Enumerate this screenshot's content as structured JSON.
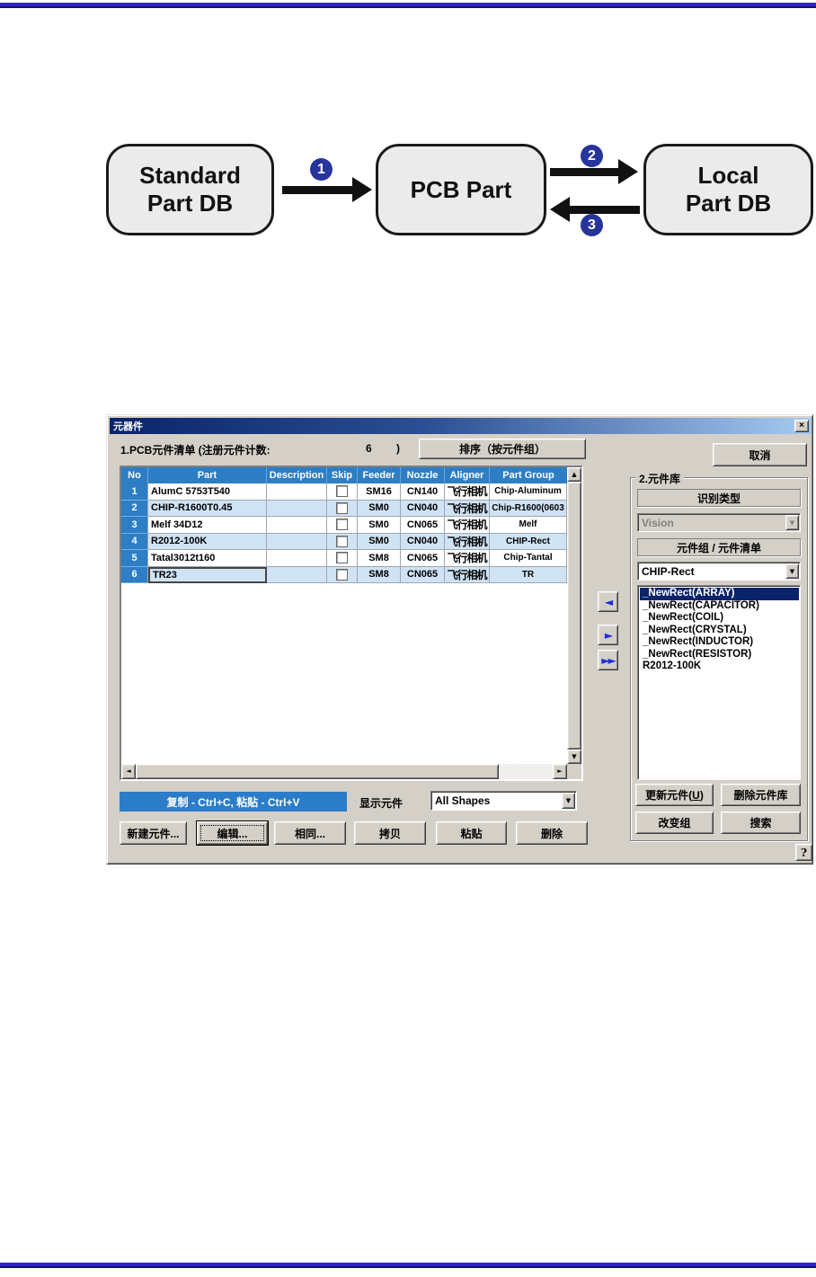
{
  "colors": {
    "accent_blue": "#2d7ec4",
    "row_alt_blue": "#cfe3f5",
    "selection_navy": "#0a246a",
    "rule_blue": "#2f22d6",
    "badge_blue": "#27349b",
    "dialog_face": "#d4d0c8",
    "title_gradient_start": "#0a246a",
    "title_gradient_end": "#a6caf0"
  },
  "diagram": {
    "boxes": [
      {
        "line1": "Standard",
        "line2": "Part DB"
      },
      {
        "line1": "PCB Part",
        "line2": ""
      },
      {
        "line1": "Local",
        "line2": "Part DB"
      }
    ],
    "steps": [
      "1",
      "2",
      "3"
    ]
  },
  "dialog": {
    "title": "元器件",
    "icons": {
      "close": "×",
      "combo_arrow": "▼",
      "scroll_up": "▲",
      "scroll_down": "▼",
      "scroll_left": "◄",
      "scroll_right": "►",
      "arrow_left": "◄",
      "arrow_right": "►",
      "arrow_double_right": "►►",
      "help": "?"
    },
    "header": {
      "list_label": "1.PCB元件清单  (注册元件计数:",
      "count": "6",
      "count_close": ")",
      "sort_button": "排序（按元件组）",
      "cancel_button": "取消"
    },
    "table": {
      "columns": [
        "No",
        "Part",
        "Description",
        "Skip",
        "Feeder",
        "Nozzle",
        "Aligner",
        "Part Group"
      ],
      "rows": [
        {
          "no": "1",
          "part": "AlumC 5753T540",
          "description": "",
          "skip": false,
          "feeder": "SM16",
          "nozzle": "CN140",
          "aligner": "飞行相机",
          "part_group": "Chip-Aluminum",
          "selected": false
        },
        {
          "no": "2",
          "part": "CHIP-R1600T0.45",
          "description": "",
          "skip": false,
          "feeder": "SM0",
          "nozzle": "CN040",
          "aligner": "飞行相机",
          "part_group": "Chip-R1600(0603",
          "selected": false
        },
        {
          "no": "3",
          "part": "Melf 34D12",
          "description": "",
          "skip": false,
          "feeder": "SM0",
          "nozzle": "CN065",
          "aligner": "飞行相机",
          "part_group": "Melf",
          "selected": false
        },
        {
          "no": "4",
          "part": "R2012-100K",
          "description": "",
          "skip": false,
          "feeder": "SM0",
          "nozzle": "CN040",
          "aligner": "飞行相机",
          "part_group": "CHIP-Rect",
          "selected": false
        },
        {
          "no": "5",
          "part": "Tatal3012t160",
          "description": "",
          "skip": false,
          "feeder": "SM8",
          "nozzle": "CN065",
          "aligner": "飞行相机",
          "part_group": "Chip-Tantal",
          "selected": false
        },
        {
          "no": "6",
          "part": "TR23",
          "description": "",
          "skip": false,
          "feeder": "SM8",
          "nozzle": "CN065",
          "aligner": "飞行相机",
          "part_group": "TR",
          "selected": true
        }
      ]
    },
    "footer": {
      "copy_hint": "复制 - Ctrl+C, 粘贴 - Ctrl+V",
      "show_label": "显示元件",
      "shape_filter": "All Shapes",
      "buttons": [
        "新建元件...",
        "编辑...",
        "相同...",
        "拷贝",
        "粘贴",
        "删除"
      ]
    },
    "library": {
      "group_title": "2.元件库",
      "recognition_label": "识别类型",
      "vision_value": "Vision",
      "group_list_label": "元件组 / 元件清单",
      "group_value": "CHIP-Rect",
      "items": [
        "_NewRect(ARRAY)",
        "_NewRect(CAPACITOR)",
        "_NewRect(COIL)",
        "_NewRect(CRYSTAL)",
        "_NewRect(INDUCTOR)",
        "_NewRect(RESISTOR)",
        "R2012-100K"
      ],
      "selected_index": 0,
      "update_button": {
        "prefix": "更新元件(",
        "key": "U",
        "suffix": ")"
      },
      "delete_lib_button": "删除元件库",
      "change_group_button": "改变组",
      "search_button": "搜索"
    },
    "help_button": "?"
  }
}
